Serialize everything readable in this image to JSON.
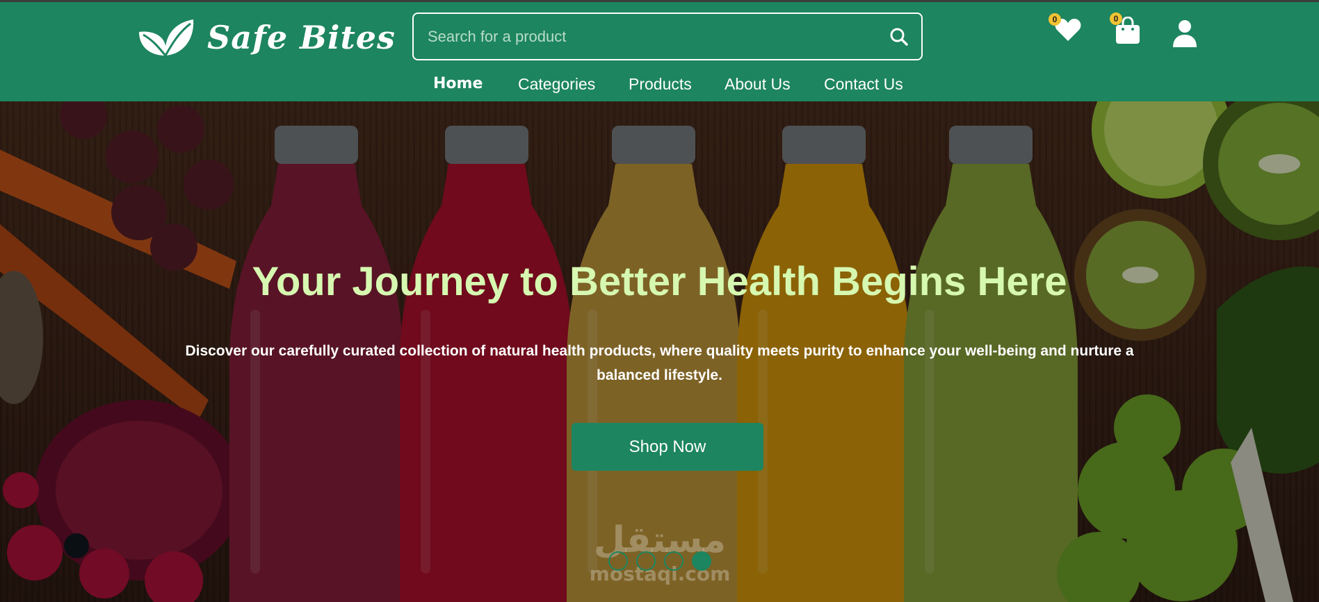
{
  "brand": {
    "name": "Safe Bites",
    "logo_icon": "leaf-icon",
    "color": "#1d8560"
  },
  "search": {
    "placeholder": "Search for a product",
    "value": "",
    "icon": "search-icon"
  },
  "header_icons": {
    "wishlist": {
      "icon": "heart-icon",
      "count": "0"
    },
    "cart": {
      "icon": "shopping-bag-icon",
      "count": "0"
    },
    "account": {
      "icon": "user-icon"
    },
    "badge_color": "#f1c232"
  },
  "nav": {
    "items": [
      {
        "label": "Home",
        "active": true
      },
      {
        "label": "Categories"
      },
      {
        "label": "Products"
      },
      {
        "label": "About Us"
      },
      {
        "label": "Contact Us"
      }
    ]
  },
  "hero": {
    "title": "Your Journey to Better Health Begins Here",
    "subtitle": "Discover our carefully curated collection of natural health products, where quality meets purity to enhance your well-being and nurture a balanced lifestyle.",
    "cta_label": "Shop Now",
    "title_color": "#d6f8b0",
    "slides_count": 4,
    "active_slide": 4
  },
  "watermark": {
    "arabic": "مستقل",
    "latin": "mostaql.com"
  }
}
